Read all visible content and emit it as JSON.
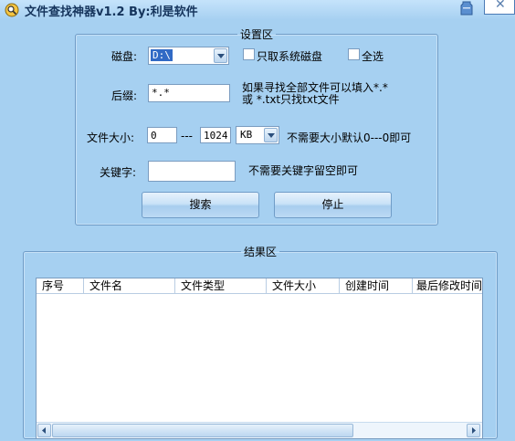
{
  "window": {
    "title": "文件查找神器v1.2   By:利是软件"
  },
  "settings": {
    "legend": "设置区",
    "disk": {
      "label": "磁盘:",
      "value": "D:\\"
    },
    "only_system_disk": {
      "label": "只取系统磁盘",
      "checked": false
    },
    "select_all": {
      "label": "全选",
      "checked": false
    },
    "suffix": {
      "label": "后缀:",
      "value": "*.*",
      "hint_line1": "如果寻找全部文件可以填入*.*",
      "hint_line2": "或 *.txt只找txt文件"
    },
    "size": {
      "label": "文件大小:",
      "min": "0",
      "separator": "---",
      "max": "1024",
      "unit": "KB",
      "hint": "不需要大小默认0---0即可"
    },
    "keyword": {
      "label": "关键字:",
      "value": "",
      "hint": "不需要关键字留空即可"
    },
    "search_button": "搜索",
    "stop_button": "停止"
  },
  "results": {
    "legend": "结果区",
    "columns": [
      "序号",
      "文件名",
      "文件类型",
      "文件大小",
      "创建时间",
      "最后修改时间"
    ],
    "rows": []
  },
  "icons": {
    "app": "magnifier-file-icon",
    "minimize": "minimize-icon",
    "close": "close-icon"
  }
}
